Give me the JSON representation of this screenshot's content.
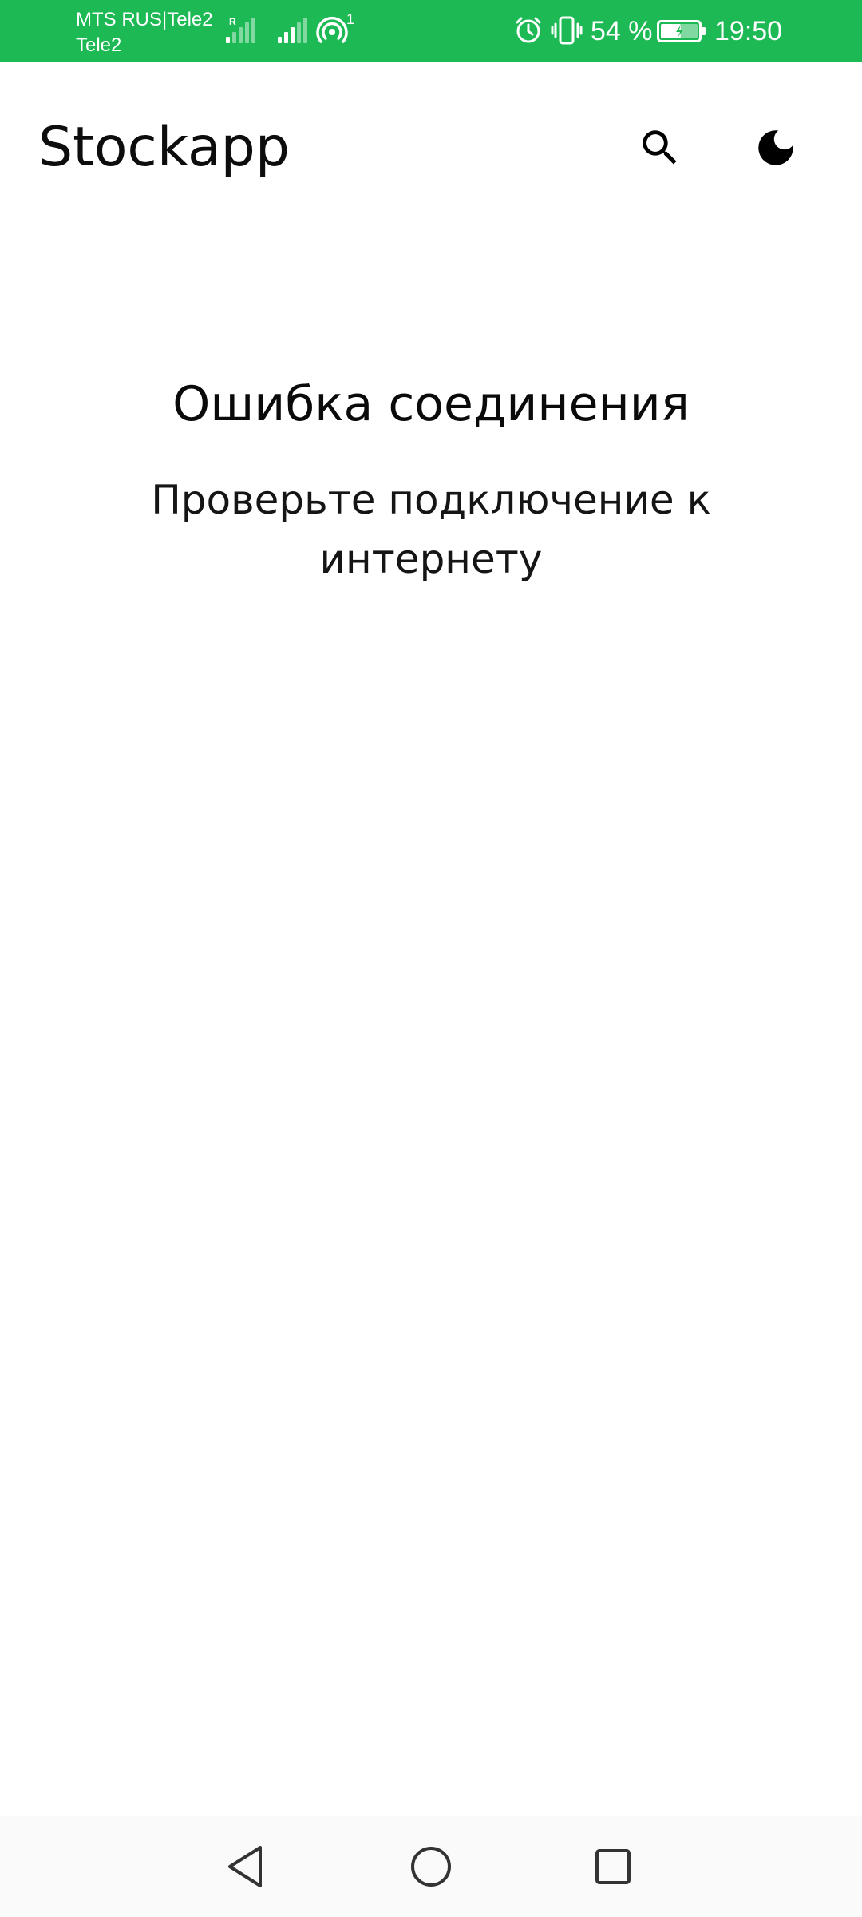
{
  "status_bar": {
    "carrier_line1": "MTS RUS|Tele2",
    "carrier_line2": "Tele2",
    "roaming_label": "R",
    "hotspot_count": "1",
    "battery_percent": "54 %",
    "battery_level": 0.54,
    "time": "19:50",
    "background_color": "#1db954",
    "icons": [
      "signal-icon",
      "signal-icon",
      "hotspot-icon",
      "alarm-icon",
      "vibrate-icon",
      "battery-icon"
    ]
  },
  "app_bar": {
    "title": "Stockapp",
    "actions": [
      "search-icon",
      "moon-icon"
    ]
  },
  "error": {
    "title": "Ошибка соединения",
    "message": "Проверьте подключение к интернету"
  },
  "nav_bar": {
    "buttons": [
      "back-icon",
      "home-icon",
      "recents-icon"
    ]
  }
}
